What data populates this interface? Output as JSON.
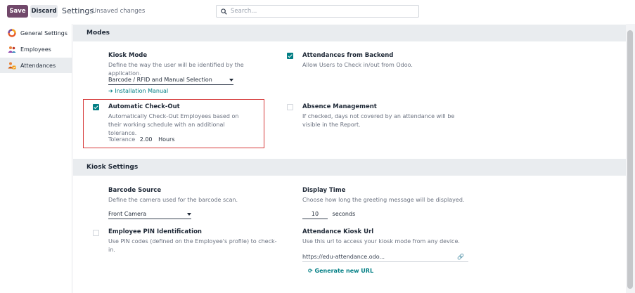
{
  "toolbar": {
    "save_label": "Save",
    "discard_label": "Discard",
    "title": "Settings",
    "status": "Unsaved changes",
    "search_placeholder": "Search..."
  },
  "sidebar": {
    "items": [
      {
        "label": "General Settings",
        "icon": "odoo-logo-icon",
        "active": false
      },
      {
        "label": "Employees",
        "icon": "employees-app-icon",
        "active": false
      },
      {
        "label": "Attendances",
        "icon": "attendances-app-icon",
        "active": true
      }
    ]
  },
  "modes": {
    "header": "Modes",
    "kiosk_mode": {
      "title": "Kiosk Mode",
      "description": "Define the way the user will be identified by the application.",
      "selected": "Barcode / RFID and Manual Selection",
      "link": "Installation Manual"
    },
    "attendances_backend": {
      "title": "Attendances from Backend",
      "description": "Allow Users to Check in/out from Odoo.",
      "checked": true
    },
    "auto_checkout": {
      "title": "Automatic Check-Out",
      "description": "Automatically Check-Out Employees based on their working schedule with an additional tolerance.",
      "checked": true,
      "tolerance_label": "Tolerance",
      "tolerance_value": "2.00",
      "tolerance_unit": "Hours"
    },
    "absence_management": {
      "title": "Absence Management",
      "description": "If checked, days not covered by an attendance will be visible in the Report.",
      "checked": false
    }
  },
  "kiosk": {
    "header": "Kiosk Settings",
    "barcode_source": {
      "title": "Barcode Source",
      "description": "Define the camera used for the barcode scan.",
      "selected": "Front Camera"
    },
    "display_time": {
      "title": "Display Time",
      "description": "Choose how long the greeting message will be displayed.",
      "value": "10",
      "unit": "seconds"
    },
    "pin_identification": {
      "title": "Employee PIN Identification",
      "description": "Use PIN codes (defined on the Employee's profile) to check-in.",
      "checked": false
    },
    "kiosk_url": {
      "title": "Attendance Kiosk Url",
      "description": "Use this url to access your kiosk mode from any device.",
      "url": "https://edu-attendance.odo...",
      "generate_label": "Generate new URL"
    }
  },
  "colors": {
    "primary": "#71486a",
    "accent": "#017e84",
    "highlight": "#d63a3a"
  }
}
